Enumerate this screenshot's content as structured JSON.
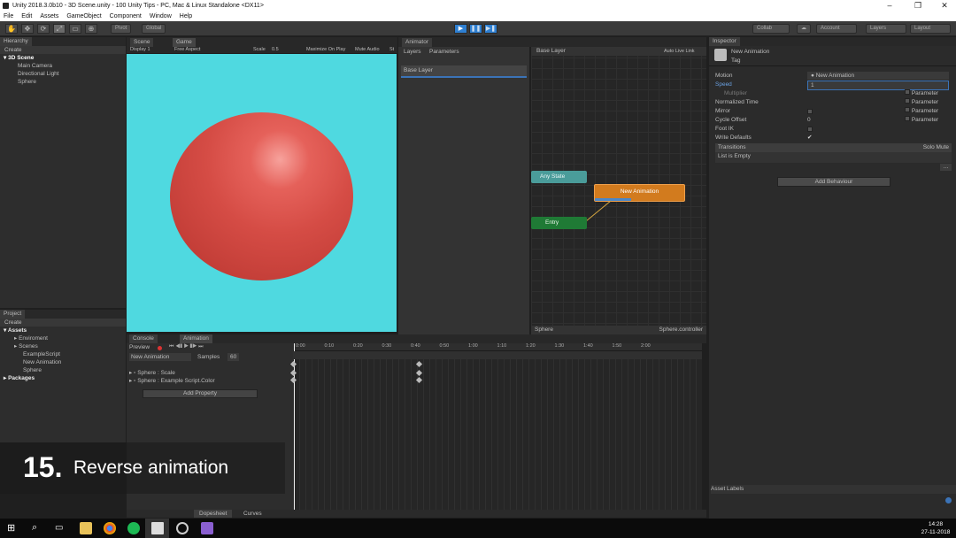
{
  "window": {
    "title": "Unity 2018.3.0b10 - 3D Scene.unity - 100 Unity Tips - PC, Mac & Linux Standalone <DX11>",
    "min": "–",
    "max": "❐",
    "close": "✕"
  },
  "menu": [
    "File",
    "Edit",
    "Assets",
    "GameObject",
    "Component",
    "Window",
    "Help"
  ],
  "toolbar": {
    "pivot": "Pivot",
    "global": "Global",
    "collab": "Collab",
    "account": "Account",
    "layers": "Layers",
    "layout": "Layout",
    "tools": [
      "✋",
      "✥",
      "⟳",
      "⤢",
      "▭",
      "⊕"
    ],
    "play": "▶",
    "pause": "❚❚",
    "step": "▶❚"
  },
  "hierarchy": {
    "tab": "Hierarchy",
    "create": "Create",
    "scene": "3D Scene",
    "items": [
      "Main Camera",
      "Directional Light",
      "Sphere"
    ]
  },
  "game": {
    "tab_scene": "Scene",
    "tab_game": "Game",
    "display": "Display 1",
    "aspect": "Free Aspect",
    "scale": "Scale",
    "scale_val": "0.5",
    "maximize": "Maximize On Play",
    "mute": "Mute Audio",
    "stats": "St",
    "bg": "#4fd9e0",
    "sphere_color": "#d9504a"
  },
  "animator": {
    "tab": "Animator",
    "layers_tab": "Layers",
    "params_tab": "Parameters",
    "base_layer": "Base Layer",
    "breadcrumb": "Base Layer",
    "auto_live": "Auto Live Link",
    "any_state": "Any State",
    "new_animation": "New Animation",
    "entry": "Entry",
    "footer_left": "Sphere",
    "footer_right": "Sphere.controller"
  },
  "project": {
    "tab": "Project",
    "create": "Create",
    "assets": "Assets",
    "items": [
      "Enviroment",
      "Scenes",
      "ExampleScript",
      "New Animation",
      "Sphere"
    ],
    "packages": "Packages"
  },
  "animation": {
    "tab_console": "Console",
    "tab_animation": "Animation",
    "preview": "Preview",
    "clip": "New Animation",
    "samples_label": "Samples",
    "samples": "60",
    "properties": [
      "Sphere : Scale",
      "Sphere : Example Script.Color"
    ],
    "add_property": "Add Property",
    "dopesheet": "Dopesheet",
    "curves": "Curves",
    "ruler": [
      "0:00",
      "0:10",
      "0:20",
      "0:30",
      "0:40",
      "0:50",
      "1:00",
      "1:10",
      "1:20",
      "1:30",
      "1:40",
      "1:50",
      "2:00"
    ]
  },
  "inspector": {
    "tab": "Inspector",
    "name": "New Animation",
    "tag": "Tag",
    "rows": [
      {
        "label": "Motion",
        "value": "New Animation"
      },
      {
        "label": "Speed",
        "value": "1"
      },
      {
        "label": "Multiplier",
        "value": "Parameter"
      },
      {
        "label": "Normalized Time",
        "value": "Parameter"
      },
      {
        "label": "Mirror",
        "value": "Parameter"
      },
      {
        "label": "Cycle Offset",
        "value": "0",
        "extra": "Parameter"
      },
      {
        "label": "Foot IK",
        "value": ""
      },
      {
        "label": "Write Defaults",
        "value": "✔"
      }
    ],
    "transitions": "Transitions",
    "solo_mute": "Solo Mute",
    "list_empty": "List is Empty",
    "add_behaviour": "Add Behaviour",
    "asset_labels": "Asset Labels"
  },
  "caption": {
    "number": "15.",
    "text": "Reverse animation"
  },
  "taskbar": {
    "time": "14:28",
    "date": "27-11-2018"
  }
}
